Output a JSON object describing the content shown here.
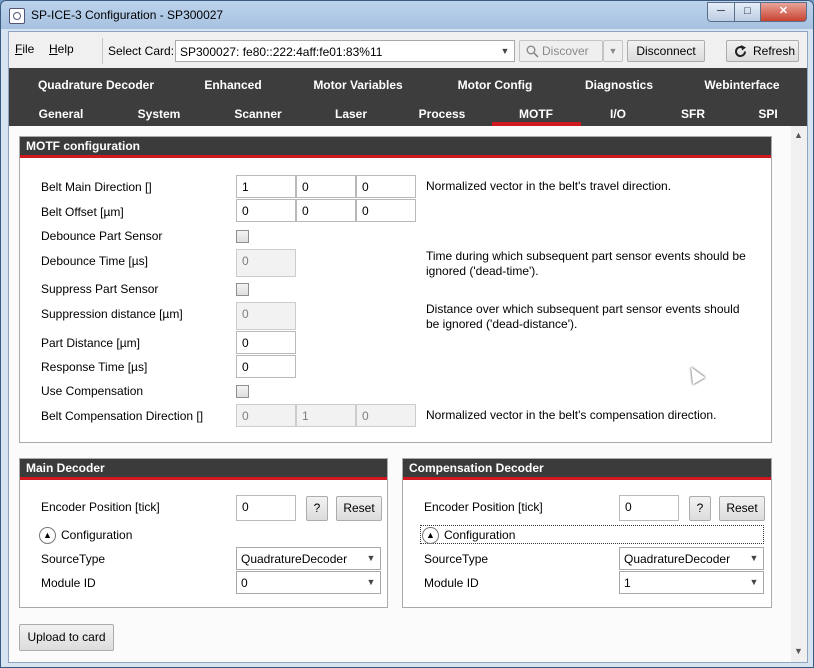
{
  "window": {
    "title": "SP-ICE-3 Configuration - SP300027"
  },
  "window_controls": {
    "minimize": "─",
    "maximize": "□",
    "close": "✕"
  },
  "menu": {
    "file": "File",
    "file_hotkey": "F",
    "file_rest": "ile",
    "help": "Help",
    "help_hotkey": "H",
    "help_rest": "elp"
  },
  "toolbar": {
    "select_card_label": "Select Card:",
    "card_value": "SP300027: fe80::222:4aff:fe01:83%11",
    "discover_label": "Discover",
    "disconnect_label": "Disconnect",
    "refresh_label": "Refresh"
  },
  "tabs": {
    "row1": [
      "Quadrature Decoder",
      "Enhanced",
      "Motor Variables",
      "Motor Config",
      "Diagnostics",
      "Webinterface"
    ],
    "row2": [
      "General",
      "System",
      "Scanner",
      "Laser",
      "Process",
      "MOTF",
      "I/O",
      "SFR",
      "SPI"
    ],
    "active": "MOTF"
  },
  "motf": {
    "title": "MOTF configuration",
    "belt_main_direction": {
      "label": "Belt Main Direction []",
      "values": [
        "1",
        "0",
        "0"
      ],
      "desc": "Normalized vector in the belt's travel direction."
    },
    "belt_offset": {
      "label": "Belt Offset [µm]",
      "values": [
        "0",
        "0",
        "0"
      ]
    },
    "debounce_part_sensor": {
      "label": "Debounce Part Sensor",
      "checked": false
    },
    "debounce_time": {
      "label": "Debounce Time [µs]",
      "value": "0",
      "desc_line1": "Time during which subsequent part sensor events should be",
      "desc_line2": "ignored ('dead-time')."
    },
    "suppress_part_sensor": {
      "label": "Suppress Part Sensor",
      "checked": false
    },
    "suppression_distance": {
      "label": "Suppression distance [µm]",
      "value": "0",
      "desc_line1": "Distance over which subsequent part sensor events should",
      "desc_line2": "be ignored ('dead-distance')."
    },
    "part_distance": {
      "label": "Part Distance [µm]",
      "value": "0"
    },
    "response_time": {
      "label": "Response Time [µs]",
      "value": "0"
    },
    "use_compensation": {
      "label": "Use Compensation",
      "checked": false
    },
    "belt_comp_direction": {
      "label": "Belt Compensation Direction []",
      "values": [
        "0",
        "1",
        "0"
      ],
      "desc": "Normalized vector in the belt's compensation direction."
    }
  },
  "main_decoder": {
    "title": "Main Decoder",
    "encoder_label": "Encoder Position [tick]",
    "encoder_value": "0",
    "help_label": "?",
    "reset_label": "Reset",
    "config_label": "Configuration",
    "source_type_label": "SourceType",
    "source_type_value": "QuadratureDecoder",
    "module_id_label": "Module ID",
    "module_id_value": "0"
  },
  "comp_decoder": {
    "title": "Compensation Decoder",
    "encoder_label": "Encoder Position [tick]",
    "encoder_value": "0",
    "help_label": "?",
    "reset_label": "Reset",
    "config_label": "Configuration",
    "source_type_label": "SourceType",
    "source_type_value": "QuadratureDecoder",
    "module_id_label": "Module ID",
    "module_id_value": "1"
  },
  "upload_label": "Upload to card",
  "icons": {
    "app": "app-icon",
    "search": "magnifier-icon",
    "refresh": "refresh-icon",
    "dropdown": "chevron-down-icon",
    "expander": "chevron-up-icon"
  },
  "colors": {
    "accent": "#d01820",
    "tab_bar": "#3d3d3d",
    "group_header": "#3b3b3b"
  }
}
